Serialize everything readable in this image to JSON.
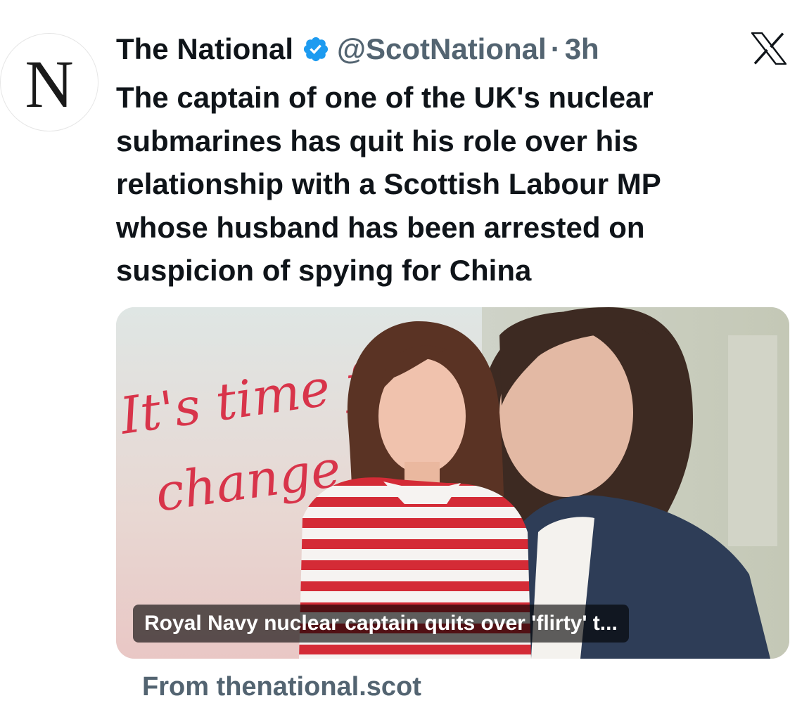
{
  "account": {
    "avatar_letter": "N",
    "name": "The National",
    "handle": "@ScotNational",
    "separator": "·",
    "time": "3h",
    "verified_icon": "verified-badge-icon",
    "verified_color": "#1d9bf0"
  },
  "platform_logo": "x-logo-icon",
  "tweet": {
    "lines": [
      "The captain of one of the UK's nuclear",
      "submarines has quit his role over his",
      "relationship with a Scottish Labour MP",
      "whose husband has been arrested on",
      "suspicion of spying for China"
    ]
  },
  "card": {
    "poster_script_line1": "It's time for",
    "poster_script_line2": "change",
    "caption": "Royal Navy nuclear captain quits over 'flirty' t...",
    "source": "From thenational.scot"
  },
  "colors": {
    "text_primary": "#0f1419",
    "text_secondary": "#536471",
    "poster_script": "#d8344a"
  }
}
